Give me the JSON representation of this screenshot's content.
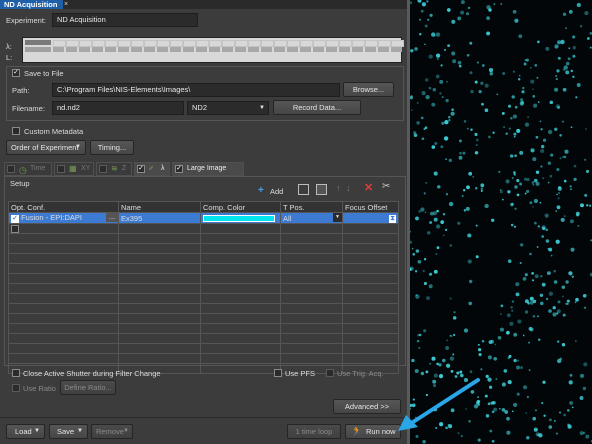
{
  "window": {
    "title": "ND Acquisition",
    "close_glyph": "×"
  },
  "experiment": {
    "label": "Experiment:",
    "value": "ND Acquisition"
  },
  "lambda_strip": {
    "lambda_label": "λ:",
    "l_label": "L:"
  },
  "save": {
    "checkbox_label": "Save to File",
    "checked": true,
    "path_label": "Path:",
    "path_value": "C:\\Program Files\\NIS-Elements\\Images\\",
    "browse_label": "Browse...",
    "filename_label": "Filename:",
    "filename_value": "nd.nd2",
    "format_value": "ND2",
    "record_label": "Record Data..."
  },
  "custom_metadata": {
    "label": "Custom Metadata",
    "checked": false
  },
  "order": {
    "order_label": "Order of Experiment",
    "timing_label": "Timing..."
  },
  "tabs": [
    {
      "label": "Time",
      "icon": "clock-icon",
      "checked": false
    },
    {
      "label": "XY",
      "icon": "grid-icon",
      "checked": false
    },
    {
      "label": "Z",
      "icon": "z-stack-icon",
      "checked": false
    },
    {
      "label": "λ",
      "icon": "lambda-icon",
      "checked": true
    },
    {
      "label": "Large Image",
      "icon": "",
      "checked": true
    }
  ],
  "setup": {
    "title": "Setup",
    "add_label": "Add",
    "columns": [
      "Opt. Conf.",
      "Name",
      "Comp. Color",
      "T Pos.",
      "Focus Offset"
    ],
    "rows": [
      {
        "opt_conf": "Fusion - EPI:DAPI",
        "more": "...",
        "name": "Ex395",
        "color": "#00e5ee",
        "tpos": "All",
        "checked": true
      },
      {
        "opt_conf": "",
        "more": "",
        "name": "",
        "color": "",
        "tpos": "",
        "checked": false
      }
    ]
  },
  "options": {
    "close_shutter_label": "Close Active Shutter during Filter Change",
    "use_pfs_label": "Use PFS",
    "use_trig_label": "Use Trig. Acq.",
    "use_ratio_label": "Use Ratio",
    "define_ratio_label": "Define Ratio..."
  },
  "advanced_label": "Advanced >>",
  "bottom": {
    "load_label": "Load",
    "save_label": "Save",
    "remove_label": "Remove",
    "time_loop_label": "1 time loop",
    "run_label": "Run now"
  },
  "colors": {
    "panel": "#3c3c3c",
    "accent": "#1f5fa8",
    "selection": "#3d7bd2",
    "arrow": "#2aa6e8",
    "nuclei": "#3fd6e0"
  }
}
